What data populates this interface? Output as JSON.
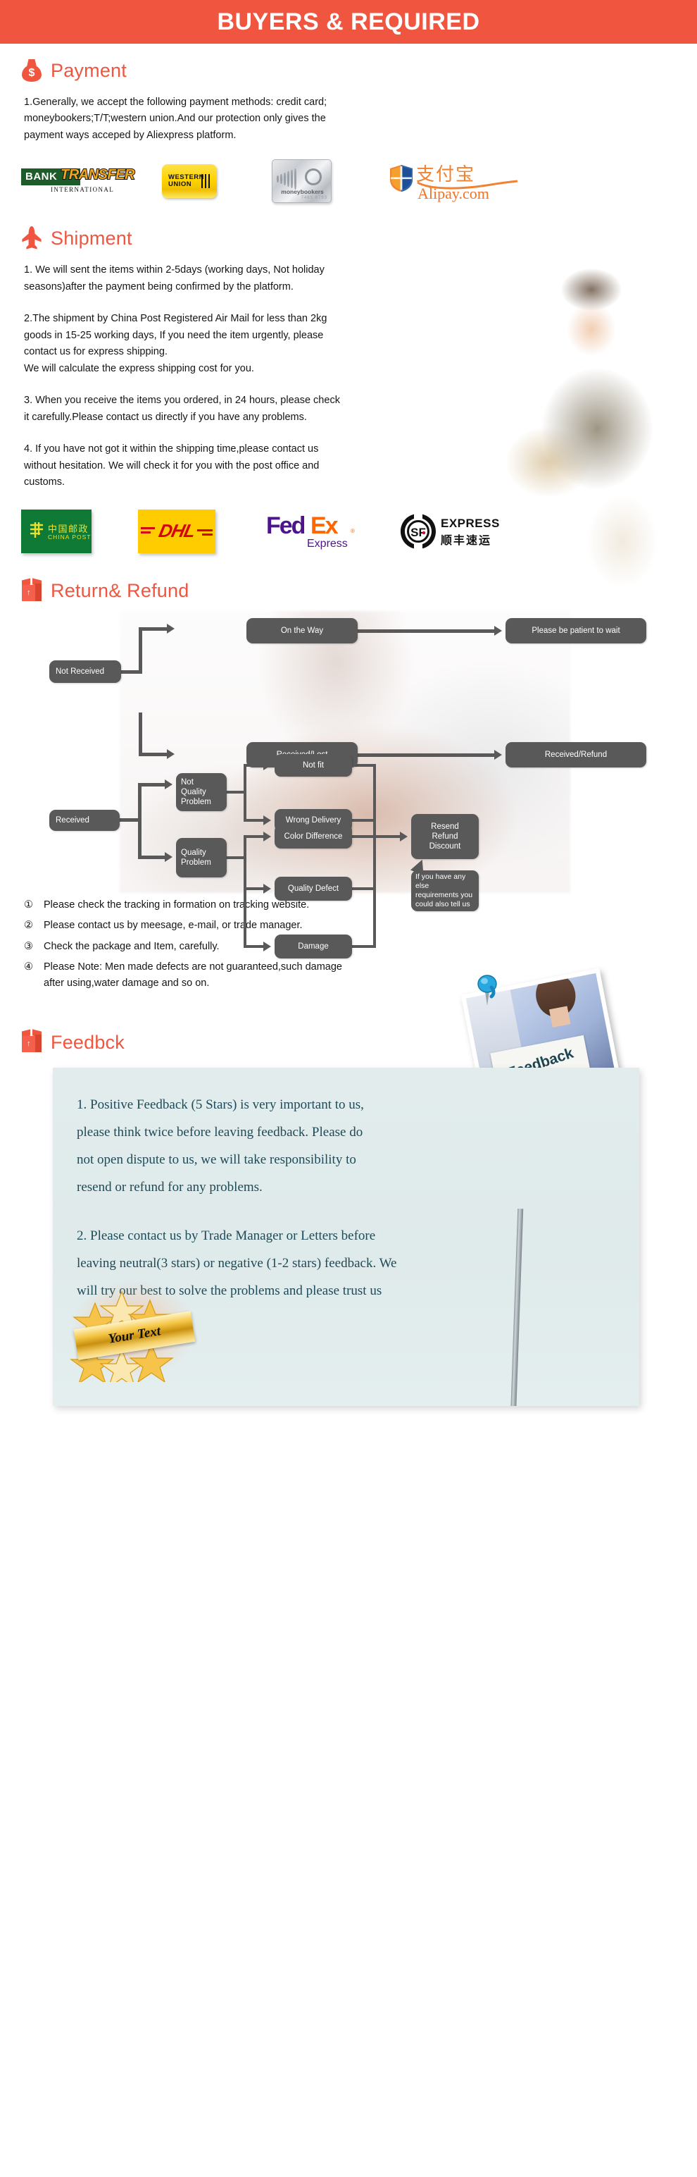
{
  "banner": {
    "title": "BUYERS & REQUIRED"
  },
  "sections": {
    "payment": {
      "heading": "Payment",
      "icon": "money-bag-icon",
      "body": "1.Generally, we accept the following payment methods: credit card;\nmoneybookers;T/T;western union.And our protection only gives the\npayment ways acceped by Aliexpress platform.",
      "logos": [
        {
          "id": "bank-transfer-logo",
          "bank": "BANK",
          "transfer": "TRANSFER",
          "international": "INTERNATIONAL"
        },
        {
          "id": "western-union-logo",
          "line1": "WESTERN",
          "line2": "UNION"
        },
        {
          "id": "moneybookers-logo",
          "name": "moneybookers",
          "digits": "7465 8793"
        },
        {
          "id": "alipay-logo",
          "cn": "支付宝",
          "com": "Alipay.com"
        }
      ]
    },
    "shipment": {
      "heading": "Shipment",
      "icon": "airplane-icon",
      "body_1": "1. We will sent the items within 2-5days (working days, Not holiday\nseasons)after the payment being confirmed by the platform.",
      "body_2": "2.The shipment by China Post Registered Air Mail for less than  2kg\ngoods in 15-25 working days, If  you need the item urgently, please\ncontact us for express shipping.\nWe will calculate the express shipping cost for you.",
      "body_3": "3. When you receive the items you ordered, in 24 hours, please check\n it carefully.Please contact us directly if you have any problems.",
      "body_4": "4. If you have not got it within the shipping time,please contact us\nwithout hesitation. We will check it for you with the post office and\ncustoms.",
      "logos": [
        {
          "id": "china-post-logo",
          "cn": "中国邮政",
          "en": "CHINA POST"
        },
        {
          "id": "dhl-logo",
          "text": "DHL"
        },
        {
          "id": "fedex-logo",
          "fed": "Fed",
          "ex": "Ex",
          "reg": "®",
          "express": "Express"
        },
        {
          "id": "sf-express-logo",
          "mark": "SF",
          "en": "EXPRESS",
          "cn": "顺丰速运"
        }
      ]
    },
    "return_refund": {
      "heading": "Return& Refund",
      "icon": "package-box-icon",
      "flowchart": {
        "nodes": [
          {
            "key": "not_received",
            "label": "Not Received"
          },
          {
            "key": "on_the_way",
            "label": "On the Way"
          },
          {
            "key": "please_wait",
            "label": "Please be patient to wait"
          },
          {
            "key": "received_lost",
            "label": "Received/Lost"
          },
          {
            "key": "received_refund",
            "label": "Received/Refund"
          },
          {
            "key": "received",
            "label": "Received"
          },
          {
            "key": "not_quality",
            "label": "Not\nQuality\nProblem"
          },
          {
            "key": "quality_problem",
            "label": "Quality\nProblem"
          },
          {
            "key": "not_fit",
            "label": "Not fit"
          },
          {
            "key": "wrong_delivery",
            "label": "Wrong Delivery"
          },
          {
            "key": "color_difference",
            "label": "Color Difference"
          },
          {
            "key": "quality_defect",
            "label": "Quality Defect"
          },
          {
            "key": "damage",
            "label": "Damage"
          },
          {
            "key": "resend",
            "label": "Resend\nRefund\nDiscount"
          },
          {
            "key": "callout",
            "label": "If you have any else\nrequirements you\ncould also tell us"
          }
        ]
      },
      "notes": [
        {
          "marker": "①",
          "text": "Please check the tracking in formation on tracking website."
        },
        {
          "marker": "②",
          "text": "Please contact us by meesage, e-mail, or trade manager."
        },
        {
          "marker": "③",
          "text": "Check the package and Item, carefully."
        },
        {
          "marker": "④",
          "text": "Please Note: Men made defects  are not guaranteed,such damage\n    after using,water damage and so on."
        }
      ]
    },
    "feedback": {
      "heading": "Feedbck",
      "icon": "package-box-icon",
      "photo_sign_text": "Feedback",
      "paragraph_1": "1. Positive Feedback (5 Stars) is very important to us,\nplease think twice before leaving feedback. Please do\nnot open dispute to us,   we will take responsibility to\nresend or refund for any problems.",
      "paragraph_2": "2. Please contact us by Trade Manager or Letters before\nleaving neutral(3 stars) or negative (1-2 stars) feedback. We\nwill try our best to solve the problems and please trust us",
      "badge_text": "Your Text"
    }
  },
  "colors": {
    "banner_bg": "#f0563f",
    "heading": "#f0563f",
    "flow_node": "#595959",
    "feedback_card_bg": "#e2ecec",
    "feedback_text": "#1f4a58"
  }
}
